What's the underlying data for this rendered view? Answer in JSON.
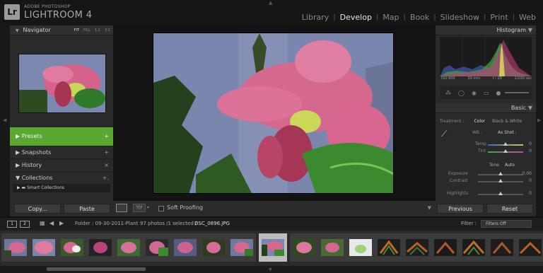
{
  "brand": {
    "badge": "Lr",
    "top": "ADOBE PHOTOSHOP",
    "main": "LIGHTROOM 4"
  },
  "modules": [
    {
      "label": "Library",
      "active": false
    },
    {
      "label": "Develop",
      "active": true
    },
    {
      "label": "Map",
      "active": false
    },
    {
      "label": "Book",
      "active": false
    },
    {
      "label": "Slideshow",
      "active": false
    },
    {
      "label": "Print",
      "active": false
    },
    {
      "label": "Web",
      "active": false
    }
  ],
  "left_panel": {
    "navigator": {
      "title": "Navigator",
      "zoom": [
        "FIT",
        "FILL",
        "1:1",
        "3:1"
      ],
      "zoom_active": "FIT"
    },
    "presets": {
      "label": "Presets",
      "action": "+"
    },
    "snapshots": {
      "label": "Snapshots",
      "action": "+"
    },
    "history": {
      "label": "History",
      "action": "×"
    },
    "collections": {
      "label": "Collections",
      "action": "+.",
      "items": [
        {
          "label": "Smart Collections"
        }
      ]
    },
    "copy_label": "Copy...",
    "paste_label": "Paste"
  },
  "center": {
    "toolbar": {
      "yy_label": "Y|Y",
      "soft_proofing": "Soft Proofing"
    }
  },
  "right_panel": {
    "histogram": {
      "title": "Histogram",
      "iso": "ISO 800",
      "focal": "30 mm",
      "aperture": "f / 29",
      "shutter": "1/200 sec"
    },
    "basic": {
      "title": "Basic",
      "treatment_label": "Treatment :",
      "color_label": "Color",
      "bw_label": "Black & White",
      "wb_label": "WB :",
      "wb_value": "As Shot :",
      "temp_label": "Temp",
      "temp_value": "0",
      "temp_pos": 0.5,
      "tint_label": "Tint",
      "tint_value": "0",
      "tint_pos": 0.5,
      "tone_label": "Tone",
      "auto_label": "Auto",
      "exposure_label": "Exposure",
      "exposure_value": "0.00",
      "exposure_pos": 0.5,
      "contrast_label": "Contrast",
      "contrast_value": "0",
      "contrast_pos": 0.5,
      "highlights_label": "Highlights",
      "highlights_value": "0",
      "highlights_pos": 0.5
    },
    "previous_label": "Previous",
    "reset_label": "Reset"
  },
  "filmstrip": {
    "monitor1": "1",
    "monitor2": "2",
    "folder": "Folder : 09-30-2011-Plant",
    "count": "97 photos /1 selected /",
    "file": "DSC_0896.JPG",
    "filter_label": "Filter :",
    "filter_value": "Filters Off"
  },
  "colors": {
    "presets_green": "#5aa82f",
    "panel": "#2a2a2a",
    "bg": "#111111"
  }
}
